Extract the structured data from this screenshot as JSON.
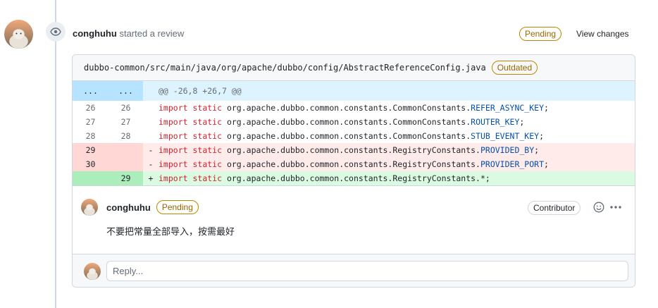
{
  "review": {
    "user": "conghuhu",
    "action": "started a review",
    "status": "Pending",
    "view_changes": "View changes"
  },
  "file": {
    "path": "dubbo-common/src/main/java/org/apache/dubbo/config/AbstractReferenceConfig.java",
    "badge": "Outdated"
  },
  "diff": {
    "hunk": {
      "old": "...",
      "new": "...",
      "header": "@@ -26,8 +26,7 @@"
    },
    "lines": [
      {
        "old": "26",
        "new": "26",
        "sign": "",
        "kw1": "import",
        "kw2": "static",
        "path": " org.apache.dubbo.common.constants.CommonConstants.",
        "const": "REFER_ASYNC_KEY",
        "tail": ";",
        "type": "ctx"
      },
      {
        "old": "27",
        "new": "27",
        "sign": "",
        "kw1": "import",
        "kw2": "static",
        "path": " org.apache.dubbo.common.constants.CommonConstants.",
        "const": "ROUTER_KEY",
        "tail": ";",
        "type": "ctx"
      },
      {
        "old": "28",
        "new": "28",
        "sign": "",
        "kw1": "import",
        "kw2": "static",
        "path": " org.apache.dubbo.common.constants.CommonConstants.",
        "const": "STUB_EVENT_KEY",
        "tail": ";",
        "type": "ctx"
      },
      {
        "old": "29",
        "new": "",
        "sign": "-",
        "kw1": "import",
        "kw2": "static",
        "path": " org.apache.dubbo.common.constants.RegistryConstants.",
        "const": "PROVIDED_BY",
        "tail": ";",
        "type": "del"
      },
      {
        "old": "30",
        "new": "",
        "sign": "-",
        "kw1": "import",
        "kw2": "static",
        "path": " org.apache.dubbo.common.constants.RegistryConstants.",
        "const": "PROVIDER_PORT",
        "tail": ";",
        "type": "del"
      },
      {
        "old": "",
        "new": "29",
        "sign": "+",
        "kw1": "import",
        "kw2": "static",
        "path": " org.apache.dubbo.common.constants.RegistryConstants.*;",
        "const": "",
        "tail": "",
        "type": "add"
      }
    ]
  },
  "comment": {
    "user": "conghuhu",
    "status": "Pending",
    "role": "Contributor",
    "body": "不要把常量全部导入，按需最好"
  },
  "reply": {
    "placeholder": "Reply..."
  },
  "colors": {
    "pending_border": "#bf8700",
    "hunk_bg": "#ddf4ff",
    "del_bg": "#ffebe9",
    "add_bg": "#dafbe1",
    "keyword": "#cf222e",
    "constant": "#0550ae"
  },
  "icons": [
    "eye-icon",
    "smiley-icon",
    "kebab-horizontal-icon"
  ]
}
